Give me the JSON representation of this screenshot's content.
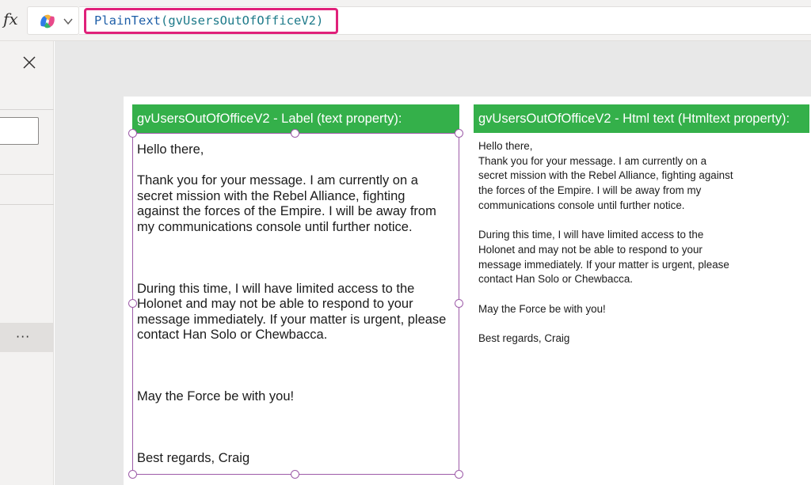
{
  "formula_bar": {
    "fx_label": "fx",
    "copilot_icon": "copilot-icon",
    "dropdown_icon": "chevron-down-icon",
    "function_name": "PlainText",
    "open_paren": "(",
    "argument": "gvUsersOutOfOfficeV2",
    "close_paren": ")"
  },
  "left_panel": {
    "close_icon": "close-icon",
    "more_icon": "more-icon",
    "more_label": "···"
  },
  "label_control": {
    "header": "gvUsersOutOfOfficeV2 - Label (text property):",
    "lines": [
      "Hello there,",
      "",
      "Thank you for your message. I am currently on a",
      "secret mission with the Rebel Alliance, fighting",
      "against the forces of the Empire. I will be away from",
      "my communications console until further notice.",
      "",
      "",
      "",
      "During this time, I will have limited access to the",
      "Holonet and may not be able to respond to your",
      "message immediately. If your matter is urgent, please",
      "contact Han Solo or Chewbacca.",
      "",
      "",
      "",
      "May the Force be with you!",
      "",
      "",
      "",
      "Best regards, Craig"
    ]
  },
  "html_control": {
    "header": "gvUsersOutOfOfficeV2 - Html text (Htmltext property):",
    "lines": [
      "Hello there,",
      "Thank you for your message. I am currently on a",
      "secret mission with the Rebel Alliance, fighting against",
      "the forces of the Empire. I will be away from my",
      "communications console until further notice.",
      "",
      "During this time, I will have limited access to the",
      "Holonet and may not be able to respond to your",
      "message immediately. If your matter is urgent, please",
      "contact Han Solo or Chewbacca.",
      "",
      "May the Force be with you!",
      "",
      "Best regards, Craig"
    ]
  },
  "colors": {
    "header_green": "#34b04a",
    "selection_purple": "#9d5ba8",
    "formula_highlight": "#e0217a"
  }
}
